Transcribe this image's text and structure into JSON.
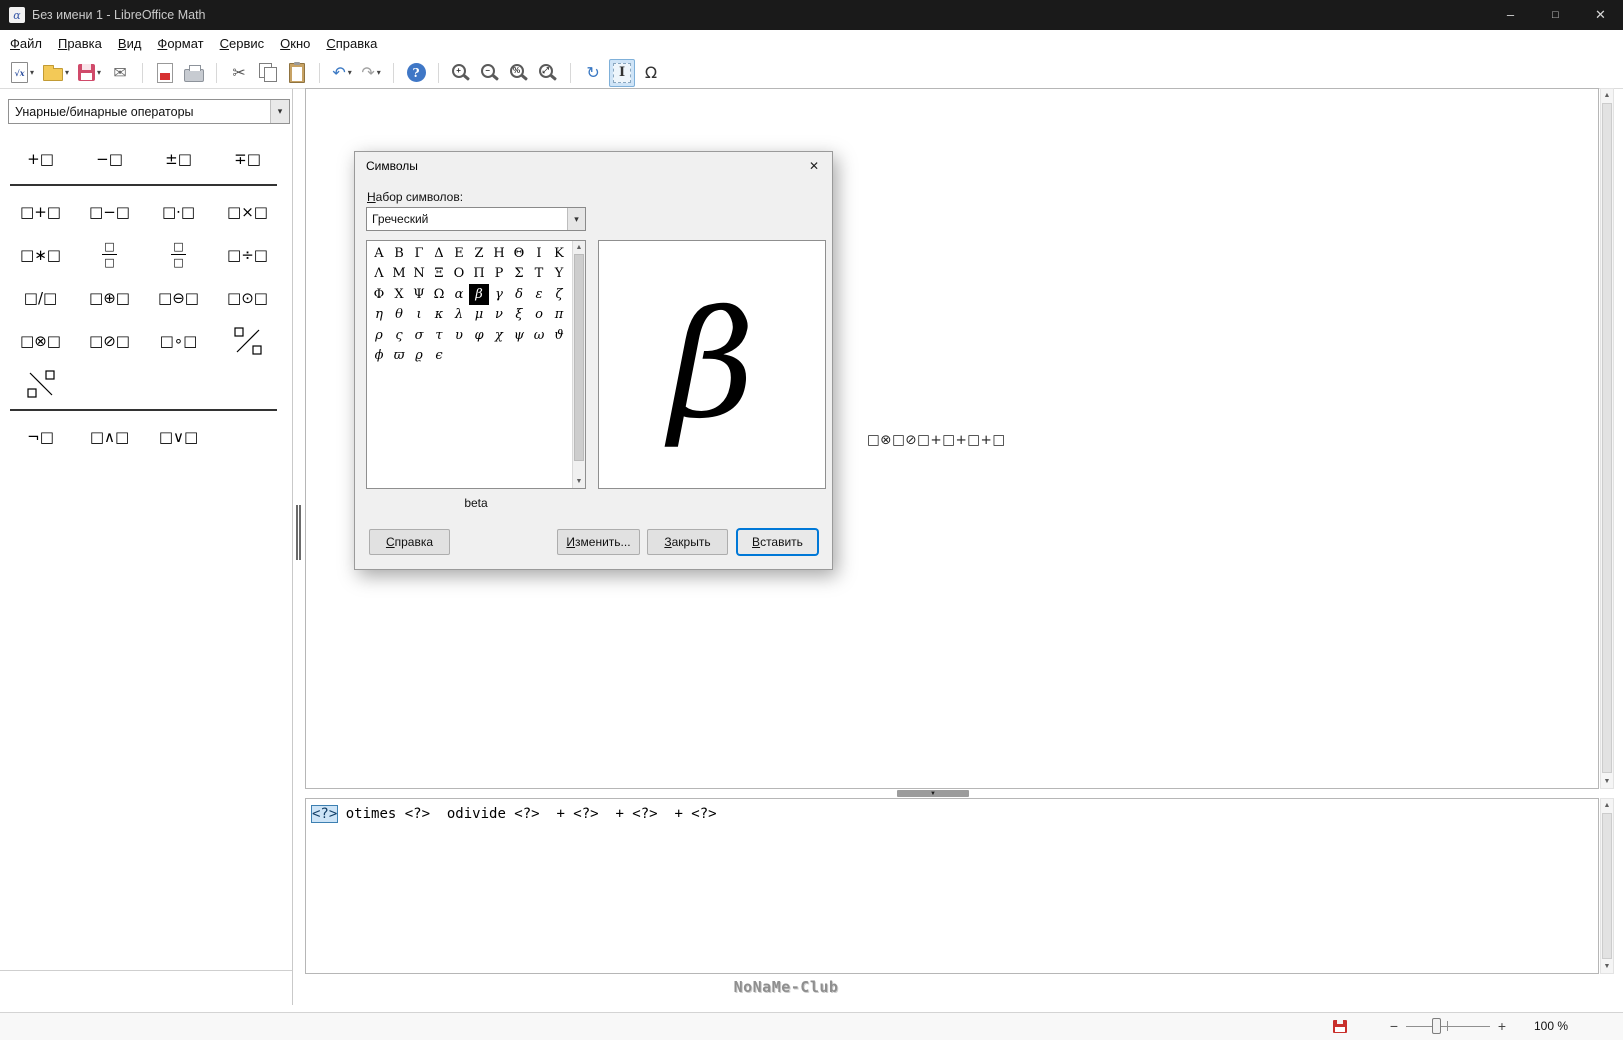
{
  "colors": {
    "accent": "#0078d7",
    "selection_bg": "#cde4f7",
    "selection_border": "#3c7fb1",
    "titlebar_bg": "#1a1a1a",
    "symbol_selected_bg": "#000000"
  },
  "icons": {
    "dropdown": "▾",
    "scroll_up": "▲",
    "scroll_down": "▼",
    "placeholder": "□"
  },
  "titlebar": {
    "icon_glyph": "α",
    "title": "Без имени 1 - LibreOffice Math",
    "minimize": "–",
    "maximize": "□",
    "close": "✕"
  },
  "menubar": {
    "items": [
      {
        "name": "file",
        "label": "Файл"
      },
      {
        "name": "edit",
        "label": "Правка"
      },
      {
        "name": "view",
        "label": "Вид"
      },
      {
        "name": "format",
        "label": "Формат"
      },
      {
        "name": "tools",
        "label": "Сервис"
      },
      {
        "name": "window",
        "label": "Окно"
      },
      {
        "name": "help",
        "label": "Справка"
      }
    ]
  },
  "toolbar": {
    "items": [
      {
        "name": "new-formula",
        "type": "new",
        "glyph": "√x",
        "dropdown": true
      },
      {
        "name": "open",
        "type": "folder",
        "dropdown": true
      },
      {
        "name": "save",
        "type": "floppy",
        "dropdown": true
      },
      {
        "name": "send-email",
        "type": "glyph",
        "glyph": "✉",
        "color": "#666666"
      },
      {
        "separator": true
      },
      {
        "name": "export-pdf",
        "type": "pdf"
      },
      {
        "name": "print",
        "type": "print"
      },
      {
        "separator": true
      },
      {
        "name": "cut",
        "type": "glyph",
        "glyph": "✂",
        "color": "#555555"
      },
      {
        "name": "copy",
        "type": "copy"
      },
      {
        "name": "paste",
        "type": "paste"
      },
      {
        "separator": true
      },
      {
        "name": "undo",
        "type": "glyph",
        "glyph": "↶",
        "color": "#3a78c3",
        "dropdown": true
      },
      {
        "name": "redo",
        "type": "glyph",
        "glyph": "↷",
        "color": "#a0a0a0",
        "dropdown": true
      },
      {
        "separator": true
      },
      {
        "name": "help",
        "type": "help",
        "glyph": "?"
      },
      {
        "separator": true
      },
      {
        "name": "zoom-in",
        "type": "mag",
        "sub": "+"
      },
      {
        "name": "zoom-out",
        "type": "mag",
        "sub": "−"
      },
      {
        "name": "zoom-100",
        "type": "mag",
        "sub": "%"
      },
      {
        "name": "show-all",
        "type": "mag",
        "sub": "⤢"
      },
      {
        "separator": true
      },
      {
        "name": "update-view",
        "type": "glyph",
        "glyph": "↻",
        "color": "#3a78c3"
      },
      {
        "name": "formula-cursor",
        "type": "cursor",
        "glyph": "I",
        "active": true
      },
      {
        "name": "symbols-catalog",
        "type": "glyph",
        "glyph": "Ω",
        "color": "#333333"
      }
    ]
  },
  "elements_panel": {
    "category": "Унарные/бинарные операторы",
    "rows": [
      {
        "items": [
          {
            "name": "unary-plus",
            "glyph": "+□"
          },
          {
            "name": "unary-minus",
            "glyph": "−□"
          },
          {
            "name": "plus-minus",
            "glyph": "±□"
          },
          {
            "name": "minus-plus",
            "glyph": "∓□"
          }
        ]
      },
      {
        "separator": true
      },
      {
        "items": [
          {
            "name": "addition",
            "glyph": "□+□"
          },
          {
            "name": "subtraction",
            "glyph": "□−□"
          },
          {
            "name": "dot-product",
            "glyph": "□⋅□"
          },
          {
            "name": "multiplication",
            "glyph": "□×□"
          }
        ]
      },
      {
        "items": [
          {
            "name": "star-product",
            "glyph": "□∗□"
          },
          {
            "name": "over",
            "type": "frac"
          },
          {
            "name": "fraction",
            "type": "frac"
          },
          {
            "name": "division",
            "glyph": "□÷□"
          }
        ]
      },
      {
        "items": [
          {
            "name": "division-slash",
            "glyph": "□/□"
          },
          {
            "name": "circled-plus",
            "glyph": "□⊕□"
          },
          {
            "name": "circled-minus",
            "glyph": "□⊖□"
          },
          {
            "name": "circled-dot",
            "glyph": "□⊙□"
          }
        ]
      },
      {
        "items": [
          {
            "name": "circled-times",
            "glyph": "□⊗□"
          },
          {
            "name": "circled-slash",
            "glyph": "□⊘□"
          },
          {
            "name": "concatenation",
            "glyph": "□∘□"
          },
          {
            "name": "wideslash",
            "type": "slash"
          }
        ]
      },
      {
        "items": [
          {
            "name": "widebslash",
            "type": "bslash"
          }
        ]
      },
      {
        "separator": true
      },
      {
        "items": [
          {
            "name": "boolean-not",
            "glyph": "¬□"
          },
          {
            "name": "boolean-and",
            "glyph": "□∧□"
          },
          {
            "name": "boolean-or",
            "glyph": "□∨□"
          }
        ]
      }
    ]
  },
  "document": {
    "formula": "□⊗□⊘□+□+□+□"
  },
  "command_editor": {
    "selected_token": "<?>",
    "rest": " otimes <?>  odivide <?>  + <?>  + <?>  + <?>"
  },
  "dialog": {
    "title": "Символы",
    "close_glyph": "✕",
    "symbol_set_label": "Набор символов:",
    "symbol_set_value": "Греческий",
    "symbols": [
      "Α",
      "Β",
      "Γ",
      "Δ",
      "Ε",
      "Ζ",
      "Η",
      "Θ",
      "Ι",
      "Κ",
      "Λ",
      "Μ",
      "Ν",
      "Ξ",
      "Ο",
      "Π",
      "Ρ",
      "Σ",
      "Τ",
      "Υ",
      "Φ",
      "Χ",
      "Ψ",
      "Ω",
      "α",
      "β",
      "γ",
      "δ",
      "ε",
      "ζ",
      "η",
      "θ",
      "ι",
      "κ",
      "λ",
      "μ",
      "ν",
      "ξ",
      "ο",
      "π",
      "ρ",
      "ς",
      "σ",
      "τ",
      "υ",
      "φ",
      "χ",
      "ψ",
      "ω",
      "ϑ",
      "ϕ",
      "ϖ",
      "ϱ",
      "ϵ"
    ],
    "selected_index": 25,
    "preview_symbol": "β",
    "symbol_name": "beta",
    "buttons": {
      "help": "Справка",
      "edit": "Изменить...",
      "close": "Закрыть",
      "insert": "Вставить"
    }
  },
  "statusbar": {
    "minus": "−",
    "plus": "+",
    "zoom_level": "100 %"
  },
  "watermark": "NoNaMe-Club"
}
